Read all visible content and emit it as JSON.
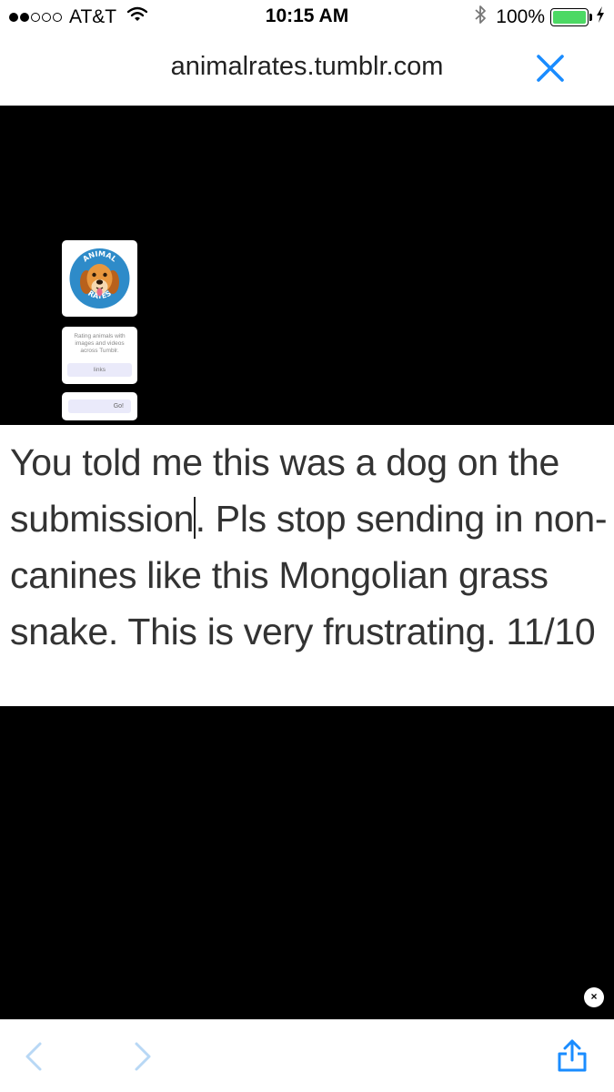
{
  "status_bar": {
    "carrier": "AT&T",
    "signal_bars_filled": 2,
    "signal_bars_total": 5,
    "time": "10:15 AM",
    "battery_percent": "100%",
    "battery_level": 1.0,
    "icons": [
      "wifi-icon",
      "bluetooth-icon",
      "battery-icon",
      "charging-icon"
    ]
  },
  "url_bar": {
    "url": "animalrates.tumblr.com",
    "close_icon": "close-icon",
    "accent_color": "#1a8cff"
  },
  "embedded_page": {
    "logo": {
      "top_text": "ANIMAL",
      "bottom_text": "RATES",
      "ring_color": "#2e8bc9"
    },
    "description": "Rating animals with images and videos across Tumblr.",
    "links_label": "links",
    "go_label": "Go!"
  },
  "caption": {
    "before_caret": "You told me this was a dog on the submission",
    "after_caret": ". Pls stop sending in non-canines like this Mongolian grass snake. This is very frustrating. 11/10"
  },
  "overlay": {
    "dismiss_label": "×"
  },
  "toolbar": {
    "back_icon": "chevron-left-icon",
    "forward_icon": "chevron-right-icon",
    "share_icon": "share-icon",
    "icon_color": "#1a8cff",
    "disabled_color": "#b8d8f5"
  }
}
